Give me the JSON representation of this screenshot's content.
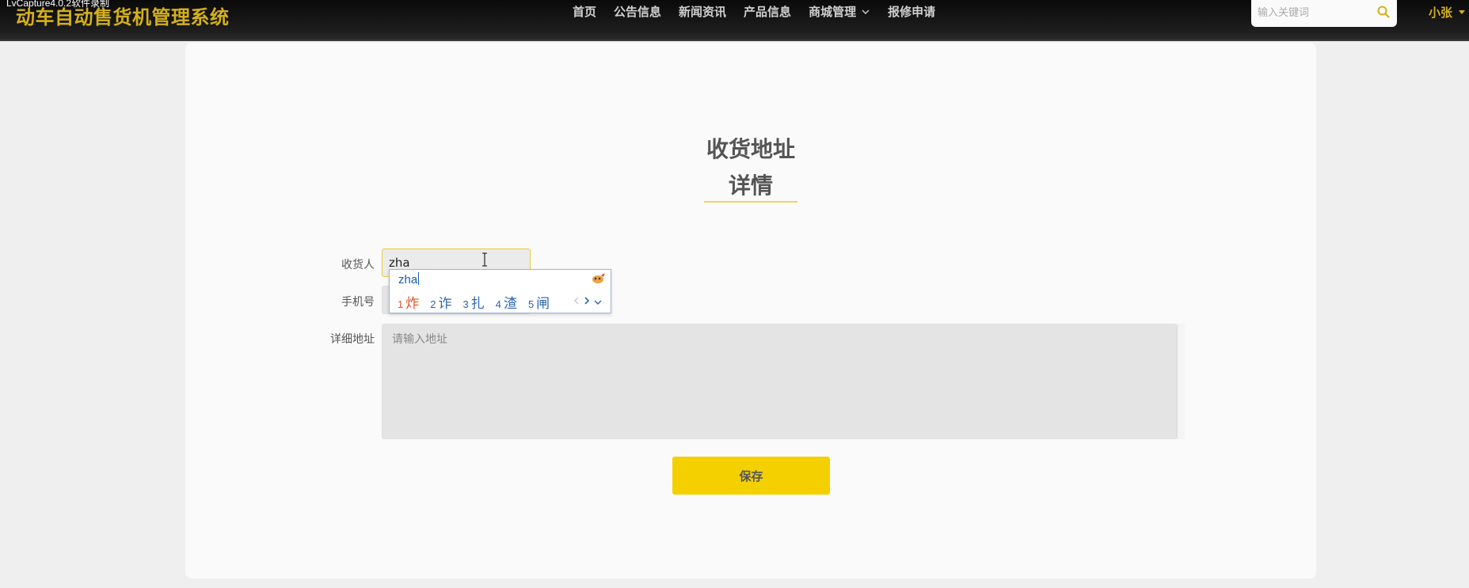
{
  "watermark": "LvCapture4.0.2软件录制",
  "header": {
    "logo": "动车自动售货机管理系统",
    "nav": [
      {
        "label": "首页"
      },
      {
        "label": "公告信息"
      },
      {
        "label": "新闻资讯"
      },
      {
        "label": "产品信息"
      },
      {
        "label": "商城管理",
        "dropdown": true
      },
      {
        "label": "报修申请"
      }
    ],
    "search": {
      "placeholder": "输入关键词",
      "icon": "search-icon"
    },
    "user": "小张"
  },
  "page": {
    "title_line1": "收货地址",
    "title_line2": "详情"
  },
  "form": {
    "receiver": {
      "label": "收货人",
      "value": "zha"
    },
    "phone": {
      "label": "手机号",
      "value": ""
    },
    "address": {
      "label": "详细地址",
      "placeholder": "请输入地址",
      "value": ""
    },
    "save_label": "保存"
  },
  "ime": {
    "composition": "zha",
    "candidates": [
      {
        "num": "1",
        "char": "炸"
      },
      {
        "num": "2",
        "char": "诈"
      },
      {
        "num": "3",
        "char": "扎"
      },
      {
        "num": "4",
        "char": "渣"
      },
      {
        "num": "5",
        "char": "闸"
      }
    ],
    "prev_icon": "chevron-left-icon",
    "next_icon": "chevron-right-icon",
    "expand_icon": "chevron-down-icon"
  },
  "colors": {
    "accent": "#f5d000",
    "logo": "#d4b01c",
    "header_bg": "#141414",
    "page_bg": "#efefef",
    "card_bg": "#fafafa"
  }
}
